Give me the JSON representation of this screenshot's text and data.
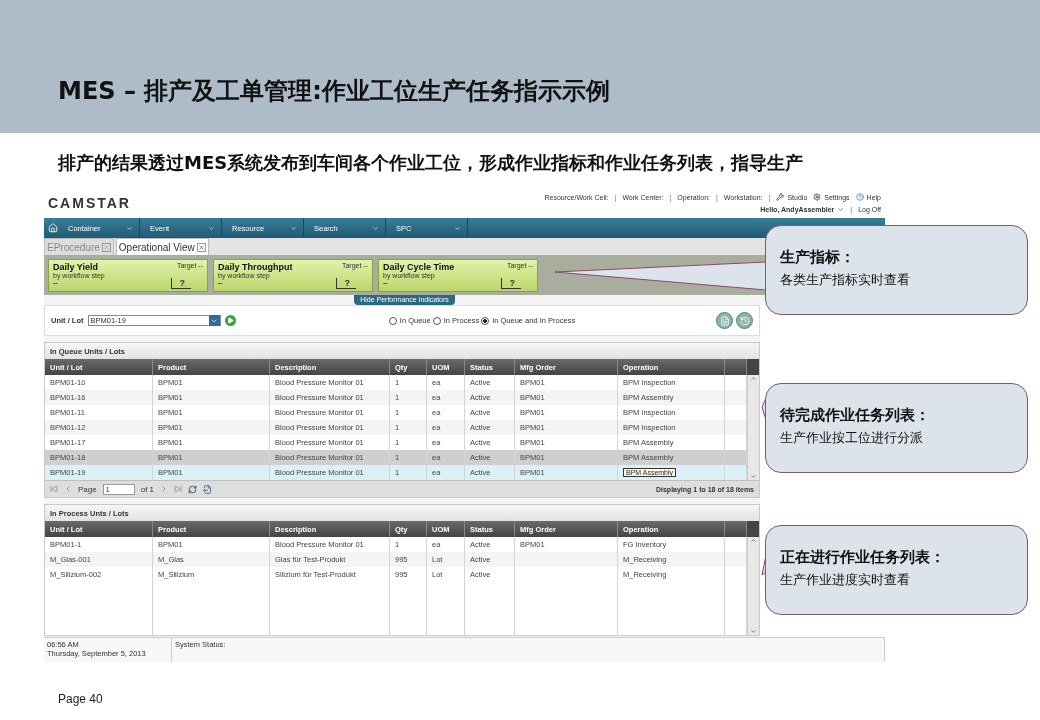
{
  "slide": {
    "title": "MES – 排产及工单管理:作业工位生产任务指示示例",
    "subtitle": "排产的结果透过MES系统发布到车间各个作业工位，形成作业指标和作业任务列表，指导生产",
    "page": "Page 40"
  },
  "app": {
    "logo": "CAMSTAR",
    "context": [
      {
        "kind": "label",
        "text": "Resource/Work Cell:"
      },
      {
        "kind": "separator",
        "text": "|"
      },
      {
        "kind": "label",
        "text": "Work Center:"
      },
      {
        "kind": "separator",
        "text": "|"
      },
      {
        "kind": "label",
        "text": "Operation:"
      },
      {
        "kind": "separator",
        "text": "|"
      },
      {
        "kind": "label",
        "text": "Workstation:"
      },
      {
        "kind": "separator",
        "text": "|"
      }
    ],
    "user_separator": "|",
    "tools": [
      {
        "kind": "studio",
        "label": "Studio"
      },
      {
        "kind": "settings",
        "label": "Settings"
      },
      {
        "kind": "help",
        "label": "Help"
      }
    ],
    "user": "Hello, AndyAssembler",
    "logoff": "Log Off",
    "menu": [
      "Container",
      "Event",
      "Resource",
      "Search",
      "SPC"
    ],
    "tabs": [
      {
        "label": "EProcedure",
        "selected": false
      },
      {
        "label": "Operational View",
        "selected": true
      }
    ],
    "indicators": [
      {
        "title": "Daily Yield",
        "sub": "by workflow step",
        "value": "--",
        "target": "Target --",
        "mark": "?"
      },
      {
        "title": "Daily Throughput",
        "sub": "by workflow step",
        "value": "--",
        "target": "Target --",
        "mark": "?"
      },
      {
        "title": "Daily Cycle Time",
        "sub": "by workflow step",
        "value": "--",
        "target": "Target --",
        "mark": "?"
      }
    ],
    "hide_indicators": "Hide Performance Indicators",
    "unit_lot": {
      "label": "Unit / Lot",
      "value": "BPM01-19"
    },
    "filter": [
      {
        "label": "In Queue",
        "selected": false
      },
      {
        "label": "In Process",
        "selected": false
      },
      {
        "label": "In Queue and In Process",
        "selected": true
      }
    ],
    "queue": {
      "title": "In Queue Units / Lots",
      "columns": [
        "Unit / Lot",
        "Product",
        "Description",
        "Qty",
        "UOM",
        "Status",
        "Mfg Order",
        "Operation"
      ],
      "rows": [
        {
          "cells": [
            "BPM01-10",
            "BPM01",
            "Blood Pressure Monitor 01",
            "1",
            "ea",
            "Active",
            "BPM01",
            "BPM Inspection"
          ],
          "selected": false,
          "highlighted": false
        },
        {
          "cells": [
            "BPM01-16",
            "BPM01",
            "Blood Pressure Monitor 01",
            "1",
            "ea",
            "Active",
            "BPM01",
            "BPM Assembly"
          ],
          "selected": false,
          "highlighted": false
        },
        {
          "cells": [
            "BPM01-11",
            "BPM01",
            "Blood Pressure Monitor 01",
            "1",
            "ea",
            "Active",
            "BPM01",
            "BPM Inspection"
          ],
          "selected": false,
          "highlighted": false
        },
        {
          "cells": [
            "BPM01-12",
            "BPM01",
            "Blood Pressure Monitor 01",
            "1",
            "ea",
            "Active",
            "BPM01",
            "BPM Inspection"
          ],
          "selected": false,
          "highlighted": false
        },
        {
          "cells": [
            "BPM01-17",
            "BPM01",
            "Blood Pressure Monitor 01",
            "1",
            "ea",
            "Active",
            "BPM01",
            "BPM Assembly"
          ],
          "selected": false,
          "highlighted": false
        },
        {
          "cells": [
            "BPM01-18",
            "BPM01",
            "Blood Pressure Monitor 01",
            "1",
            "ea",
            "Active",
            "BPM01",
            "BPM Assembly"
          ],
          "selected": false,
          "highlighted": true
        },
        {
          "cells": [
            "BPM01-19",
            "BPM01",
            "Blood Pressure Monitor 01",
            "1",
            "ea",
            "Active",
            "BPM01"
          ],
          "tooltip": "BPM Assembly",
          "selected": true,
          "highlighted": false
        }
      ],
      "pager": {
        "label": "Page",
        "page": "1",
        "of": "of 1",
        "summary": "Displaying 1 to 18 of 18 items"
      }
    },
    "in_process": {
      "title": "In Process Unts / Lots",
      "columns": [
        "Unit / Lot",
        "Product",
        "Description",
        "Qty",
        "UOM",
        "Status",
        "Mfg Order",
        "Operation"
      ],
      "rows": [
        {
          "cells": [
            "BPM01-1",
            "BPM01",
            "Blood Pressure Monitor 01",
            "1",
            "ea",
            "Active",
            "BPM01",
            "FG Inventory"
          ]
        },
        {
          "cells": [
            "M_Glas-001",
            "M_Glas",
            "Glas für Test-Produkt",
            "995",
            "Lot",
            "Active",
            "",
            "M_Receiving"
          ]
        },
        {
          "cells": [
            "M_Silizium-002",
            "M_Silizium",
            "Silizium für Test-Produkt",
            "995",
            "Lot",
            "Active",
            "",
            "M_Receiving"
          ]
        }
      ]
    },
    "status": {
      "time": "06:56 AM",
      "date": "Thursday, September 5, 2013",
      "label": "System Status:"
    }
  },
  "callouts": [
    {
      "title": "生产指标：",
      "text": "各类生产指标实时查看"
    },
    {
      "title": "待完成作业任务列表：",
      "text": "生产作业按工位进行分派"
    },
    {
      "title": "正在进行作业任务列表：",
      "text": "生产作业进度实时查看"
    }
  ]
}
